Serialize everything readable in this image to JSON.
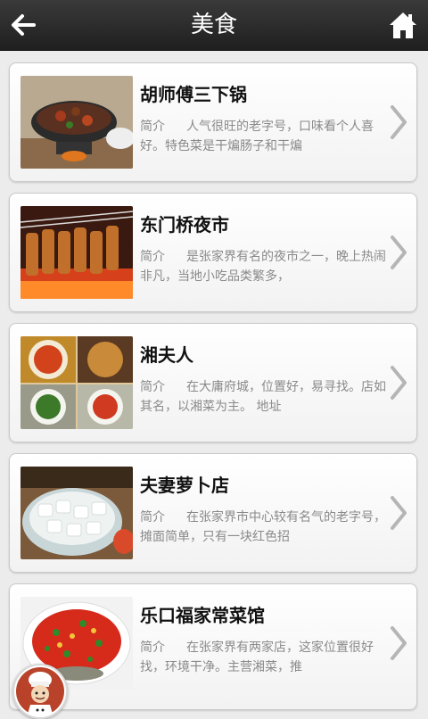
{
  "header": {
    "title": "美食",
    "back_icon": "back-arrow-icon",
    "home_icon": "home-icon"
  },
  "items": [
    {
      "title": "胡师傅三下锅",
      "label": "简介",
      "desc": "人气很旺的老字号，口味看个人喜好。特色菜是干煸肠子和干煸"
    },
    {
      "title": "东门桥夜市",
      "label": "简介",
      "desc": "是张家界有名的夜市之一，晚上热闹非凡，当地小吃品类繁多，"
    },
    {
      "title": "湘夫人",
      "label": "简介",
      "desc": "在大庸府城，位置好，易寻找。店如其名，以湘菜为主。 地址"
    },
    {
      "title": "夫妻萝卜店",
      "label": "简介",
      "desc": "在张家界市中心较有名气的老字号，摊面简单，只有一块红色招"
    },
    {
      "title": "乐口福家常菜馆",
      "label": "简介",
      "desc": "在张家界有两家店，这家位置很好找，环境干净。主营湘菜，推"
    }
  ],
  "colors": {
    "topbar": "#2a2a2a",
    "title_text": "#111111",
    "desc_text": "#8a8a8a"
  }
}
